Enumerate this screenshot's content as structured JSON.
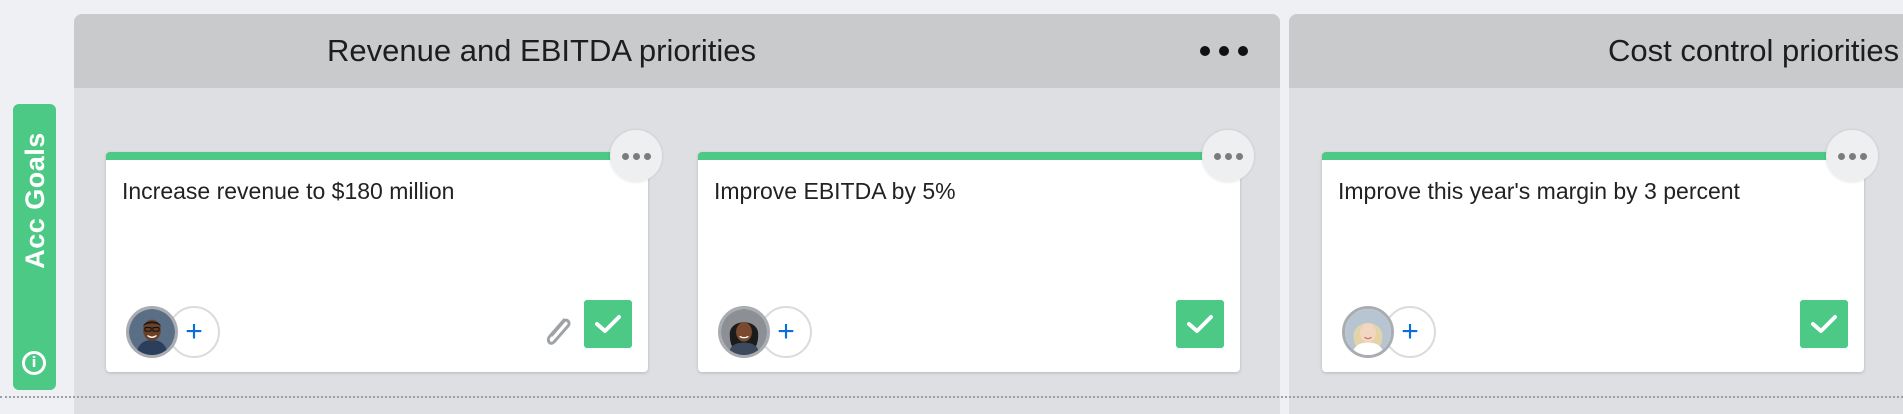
{
  "swimlane": {
    "label": "Acc Goals",
    "color": "#4bc985",
    "info_icon": "info-icon"
  },
  "columns": [
    {
      "title": "Revenue and EBITDA priorities",
      "menu_icon": "more-horizontal-icon",
      "cards": [
        {
          "title": "Increase revenue to $180 million",
          "avatar": "man-avatar",
          "add_icon": "+",
          "has_attachment": true,
          "status": "complete"
        },
        {
          "title": "Improve EBITDA by 5%",
          "avatar": "woman-avatar",
          "add_icon": "+",
          "has_attachment": false,
          "status": "complete"
        }
      ]
    },
    {
      "title": "Cost control priorities",
      "menu_icon": "more-horizontal-icon",
      "cards": [
        {
          "title": "Improve this year's margin by 3 percent",
          "avatar": "blonde-woman-avatar",
          "add_icon": "+",
          "has_attachment": false,
          "status": "complete"
        }
      ]
    }
  ],
  "colors": {
    "accent_green": "#4bc985",
    "column_bg": "#dddfe2",
    "header_bg": "#c9cacc",
    "add_blue": "#0a6fd8"
  }
}
